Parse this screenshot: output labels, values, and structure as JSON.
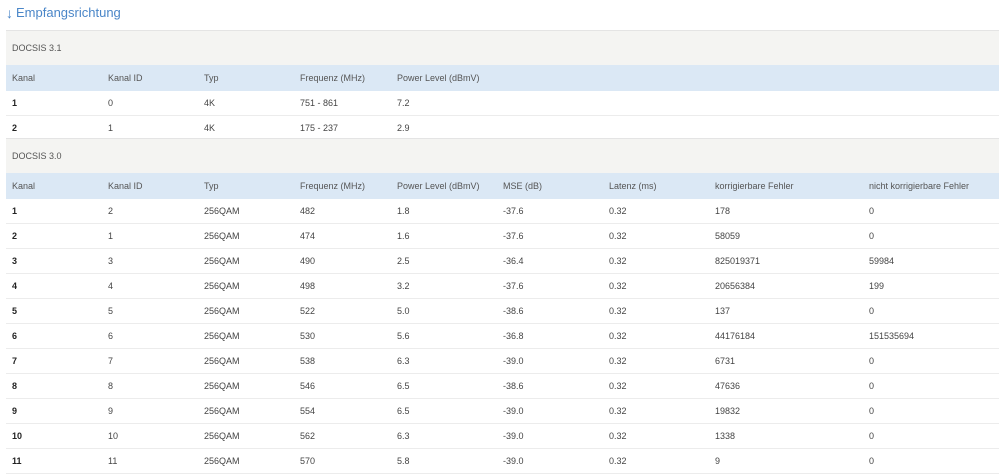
{
  "heading": {
    "arrow": "↓",
    "label": "Empfangsrichtung"
  },
  "docsis31": {
    "title": "DOCSIS 3.1",
    "columns": [
      "Kanal",
      "Kanal ID",
      "Typ",
      "Frequenz (MHz)",
      "Power Level (dBmV)"
    ],
    "rows": [
      [
        "1",
        "0",
        "4K",
        "751 - 861",
        "7.2"
      ],
      [
        "2",
        "1",
        "4K",
        "175 - 237",
        "2.9"
      ]
    ]
  },
  "docsis30": {
    "title": "DOCSIS 3.0",
    "columns": [
      "Kanal",
      "Kanal ID",
      "Typ",
      "Frequenz (MHz)",
      "Power Level (dBmV)",
      "MSE (dB)",
      "Latenz (ms)",
      "korrigierbare Fehler",
      "nicht korrigierbare Fehler"
    ],
    "rows": [
      [
        "1",
        "2",
        "256QAM",
        "482",
        "1.8",
        "-37.6",
        "0.32",
        "178",
        "0"
      ],
      [
        "2",
        "1",
        "256QAM",
        "474",
        "1.6",
        "-37.6",
        "0.32",
        "58059",
        "0"
      ],
      [
        "3",
        "3",
        "256QAM",
        "490",
        "2.5",
        "-36.4",
        "0.32",
        "825019371",
        "59984"
      ],
      [
        "4",
        "4",
        "256QAM",
        "498",
        "3.2",
        "-37.6",
        "0.32",
        "20656384",
        "199"
      ],
      [
        "5",
        "5",
        "256QAM",
        "522",
        "5.0",
        "-38.6",
        "0.32",
        "137",
        "0"
      ],
      [
        "6",
        "6",
        "256QAM",
        "530",
        "5.6",
        "-36.8",
        "0.32",
        "44176184",
        "151535694"
      ],
      [
        "7",
        "7",
        "256QAM",
        "538",
        "6.3",
        "-39.0",
        "0.32",
        "6731",
        "0"
      ],
      [
        "8",
        "8",
        "256QAM",
        "546",
        "6.5",
        "-38.6",
        "0.32",
        "47636",
        "0"
      ],
      [
        "9",
        "9",
        "256QAM",
        "554",
        "6.5",
        "-39.0",
        "0.32",
        "19832",
        "0"
      ],
      [
        "10",
        "10",
        "256QAM",
        "562",
        "6.3",
        "-39.0",
        "0.32",
        "1338",
        "0"
      ],
      [
        "11",
        "11",
        "256QAM",
        "570",
        "5.8",
        "-39.0",
        "0.32",
        "9",
        "0"
      ]
    ]
  }
}
